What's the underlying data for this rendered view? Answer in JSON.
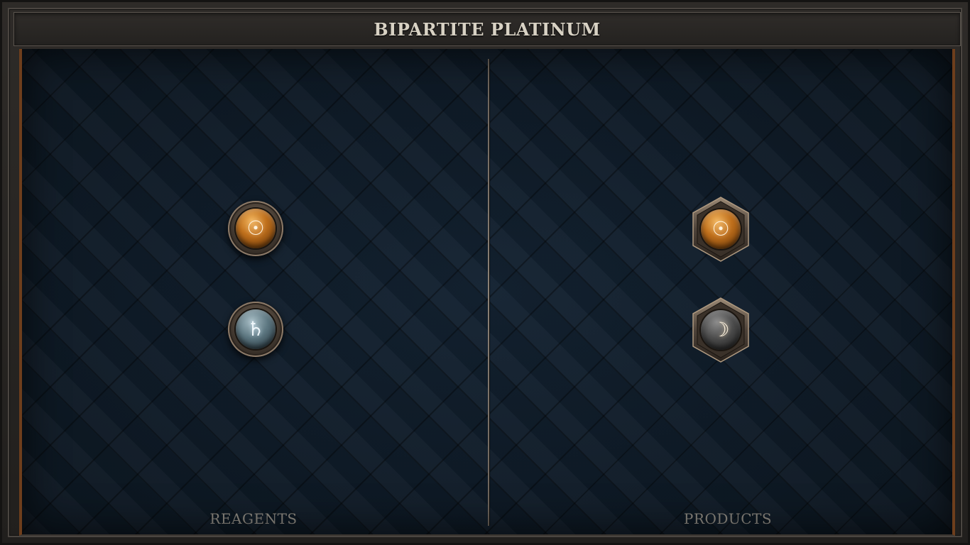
{
  "window": {
    "title": "BIPARTITE PLATINUM"
  },
  "reagents": {
    "label": "REAGENTS",
    "items": [
      {
        "name": "gold",
        "symbol": "☉",
        "icon": "sun-gold-icon",
        "color": "#c0701c"
      },
      {
        "name": "lead",
        "symbol": "♄",
        "icon": "saturn-lead-icon",
        "color": "#5c7680"
      }
    ]
  },
  "products": {
    "label": "PRODUCTS",
    "items": [
      {
        "name": "gold",
        "symbol": "☉",
        "icon": "sun-gold-icon",
        "color": "#c0701c"
      },
      {
        "name": "silver",
        "symbol": "☽",
        "icon": "moon-silver-icon",
        "color": "#4c4c4c"
      }
    ]
  },
  "colors": {
    "board_background": "#0f1a24",
    "frame": "#2e2b28",
    "accent_border": "#6e3e1c",
    "title_text": "#d8d2c4",
    "label_text": "#8e8a82"
  }
}
